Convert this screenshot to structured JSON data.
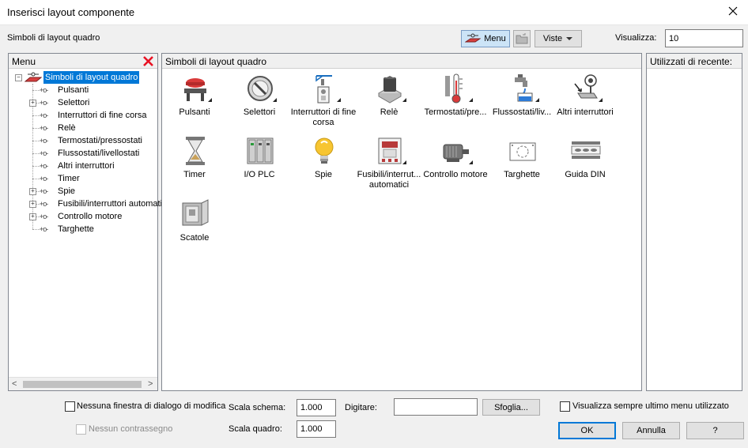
{
  "window": {
    "title": "Inserisci layout componente"
  },
  "toolbar": {
    "label": "Simboli di layout quadro",
    "menu_button": "Menu",
    "viste_button": "Viste",
    "visualizza_label": "Visualizza:",
    "visualizza_value": "10"
  },
  "menu_panel": {
    "header": "Menu",
    "root": "Simboli di layout quadro",
    "items": [
      {
        "label": "Pulsanti",
        "expandable": false
      },
      {
        "label": "Selettori",
        "expandable": true
      },
      {
        "label": "Interruttori di fine corsa",
        "expandable": false
      },
      {
        "label": "Relè",
        "expandable": false
      },
      {
        "label": "Termostati/pressostati",
        "expandable": false
      },
      {
        "label": "Flussostati/livellostati",
        "expandable": false
      },
      {
        "label": "Altri interruttori",
        "expandable": false
      },
      {
        "label": "Timer",
        "expandable": false
      },
      {
        "label": "Spie",
        "expandable": true
      },
      {
        "label": "Fusibili/interruttori automatici",
        "expandable": true
      },
      {
        "label": "Controllo motore",
        "expandable": true
      },
      {
        "label": "Targhette",
        "expandable": false
      }
    ],
    "tree_symbol": "+o-"
  },
  "symbols_panel": {
    "header": "Simboli di layout quadro",
    "icons": [
      {
        "label": "Pulsanti",
        "icon": "push-button-icon"
      },
      {
        "label": "Selettori",
        "icon": "selector-switch-icon"
      },
      {
        "label": "Interruttori di fine corsa",
        "icon": "limit-switch-icon"
      },
      {
        "label": "Relè",
        "icon": "relay-icon"
      },
      {
        "label": "Termostati/pre...",
        "icon": "thermometer-icon"
      },
      {
        "label": "Flussostati/liv...",
        "icon": "faucet-icon"
      },
      {
        "label": "Altri interruttori",
        "icon": "other-switch-icon"
      },
      {
        "label": "Timer",
        "icon": "hourglass-icon"
      },
      {
        "label": "I/O PLC",
        "icon": "plc-icon"
      },
      {
        "label": "Spie",
        "icon": "bulb-icon"
      },
      {
        "label": "Fusibili/interrut... automatici",
        "icon": "fuse-icon"
      },
      {
        "label": "Controllo motore",
        "icon": "motor-icon"
      },
      {
        "label": "Targhette",
        "icon": "nameplate-icon"
      },
      {
        "label": "Guida DIN",
        "icon": "din-rail-icon"
      },
      {
        "label": "Scatole",
        "icon": "enclosure-icon"
      }
    ]
  },
  "recent_panel": {
    "header": "Utilizzati di recente:"
  },
  "bottom": {
    "no_dialog": "Nessuna finestra di dialogo di modifica",
    "no_tag": "Nessun contrassegno",
    "scala_schema_label": "Scala schema:",
    "scala_schema_value": "1.000",
    "scala_quadro_label": "Scala quadro:",
    "scala_quadro_value": "1.000",
    "digitare_label": "Digitare:",
    "digitare_value": "",
    "sfoglia": "Sfoglia...",
    "always_last_menu": "Visualizza sempre ultimo menu utilizzato",
    "ok": "OK",
    "annulla": "Annulla",
    "help": "?"
  },
  "colors": {
    "accent": "#0078d7",
    "close_red": "#e81123"
  }
}
